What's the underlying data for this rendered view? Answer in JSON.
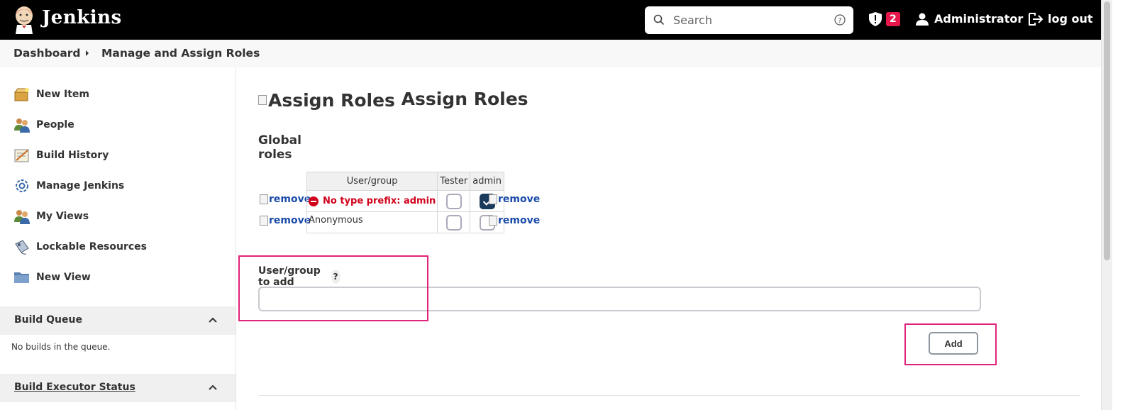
{
  "header": {
    "brand": "Jenkins",
    "search_placeholder": "Search",
    "security_count": "2",
    "user": "Administrator",
    "logout": "log out"
  },
  "breadcrumb": [
    "Dashboard",
    "Manage and Assign Roles"
  ],
  "sidebar": {
    "tasks": [
      {
        "label": "New Item",
        "icon": "new-item-icon"
      },
      {
        "label": "People",
        "icon": "people-icon"
      },
      {
        "label": "Build History",
        "icon": "notepad-icon"
      },
      {
        "label": "Manage Jenkins",
        "icon": "gear-icon"
      },
      {
        "label": "My Views",
        "icon": "people-icon"
      },
      {
        "label": "Lockable Resources",
        "icon": "lockable-icon"
      },
      {
        "label": "New View",
        "icon": "folder-icon"
      }
    ],
    "build_queue": {
      "title": "Build Queue",
      "empty": "No builds in the queue."
    },
    "executor": {
      "title": "Build Executor Status"
    }
  },
  "main": {
    "title": "Assign Roles",
    "title_img_alt": "Assign Roles",
    "section": "Global roles",
    "table": {
      "headers": [
        "User/group",
        "Tester",
        "admin"
      ],
      "rows": [
        {
          "user": "No type prefix: admin",
          "error": true,
          "tester": false,
          "admin": true
        },
        {
          "user": "Anonymous",
          "error": false,
          "tester": false,
          "admin": false
        }
      ],
      "remove_label": "remove"
    },
    "add_field": {
      "label": "User/group to add",
      "help": "?",
      "value": ""
    },
    "add_button": "Add"
  },
  "colors": {
    "header_bg": "#000000",
    "badge": "#e6174b",
    "checked": "#1a3a5c",
    "error": "#d0021b",
    "highlight": "#e0237a"
  }
}
